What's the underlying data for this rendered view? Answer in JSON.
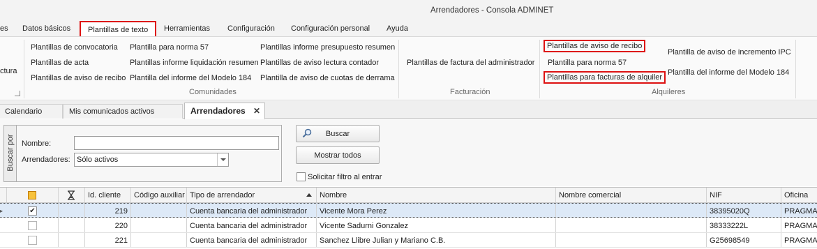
{
  "window": {
    "title": "Arrendadores - Consola ADMINET"
  },
  "ribbon_tabs": [
    {
      "label": "es"
    },
    {
      "label": "Datos básicos"
    },
    {
      "label": "Plantillas de texto",
      "active": true
    },
    {
      "label": "Herramientas"
    },
    {
      "label": "Configuración"
    },
    {
      "label": "Configuración personal"
    },
    {
      "label": "Ayuda"
    }
  ],
  "ribbon": {
    "partial_item": "ctura",
    "comunidades": {
      "label": "Comunidades",
      "col1": [
        "Plantillas de convocatoria",
        "Plantillas de acta",
        "Plantillas de aviso de recibo"
      ],
      "col2": [
        "Plantilla para norma 57",
        "Plantillas informe liquidación resumen",
        "Plantilla del informe del Modelo 184"
      ],
      "col3": [
        "Plantillas informe presupuesto resumen",
        "Plantillas de aviso lectura contador",
        "Plantilla de aviso de cuotas de derrama"
      ]
    },
    "facturacion": {
      "label": "Facturación",
      "items": [
        "Plantillas de factura del administrador"
      ]
    },
    "alquileres": {
      "label": "Alquileres",
      "col1": [
        "Plantillas de aviso de recibo",
        "Plantilla para norma 57",
        "Plantillas para facturas de alquiler"
      ],
      "col2": [
        "Plantilla de aviso de incremento IPC",
        "Plantilla del informe del Modelo 184"
      ]
    }
  },
  "doc_tabs": [
    {
      "label": "Calendario"
    },
    {
      "label": "Mis comunicados activos"
    },
    {
      "label": "Arrendadores",
      "active": true,
      "close": "✕"
    }
  ],
  "search": {
    "group_label": "Buscar por",
    "nombre_label": "Nombre:",
    "nombre_value": "",
    "arrendadores_label": "Arrendadores:",
    "arrendadores_value": "Sólo activos",
    "buscar_button": "Buscar",
    "mostrar_button": "Mostrar todos",
    "filtro_label": "Solicitar filtro al entrar",
    "filtro_checked": false
  },
  "grid": {
    "columns": [
      "",
      "",
      "",
      "Id. cliente",
      "Código auxiliar",
      "Tipo de arrendador",
      "Nombre",
      "Nombre comercial",
      "NIF",
      "Oficina"
    ],
    "rows": [
      {
        "checked": true,
        "id": "219",
        "aux": "",
        "tipo": "Cuenta bancaria del administrador",
        "nombre": "Vicente Mora Perez",
        "comercial": "",
        "nif": "38395020Q",
        "oficina": "PRAGMA",
        "selected": true
      },
      {
        "checked": false,
        "id": "220",
        "aux": "",
        "tipo": "Cuenta bancaria del administrador",
        "nombre": "Vicente Sadurni Gonzalez",
        "comercial": "",
        "nif": "38333222L",
        "oficina": "PRAGMA"
      },
      {
        "checked": false,
        "id": "221",
        "aux": "",
        "tipo": "Cuenta bancaria del administrador",
        "nombre": "Sanchez Llibre Julian y Mariano C.B.",
        "comercial": "",
        "nif": "G25698549",
        "oficina": "PRAGMA"
      }
    ]
  },
  "colors": {
    "highlight_border": "#dd1111",
    "selected_row": "#dde9f7"
  },
  "icons": [
    "magnifier-icon",
    "hourglass-icon",
    "sort-ascending-icon",
    "close-icon",
    "dropdown-arrow-icon",
    "checkbox-icon",
    "dialog-launcher-icon",
    "row-indicator-icon"
  ]
}
